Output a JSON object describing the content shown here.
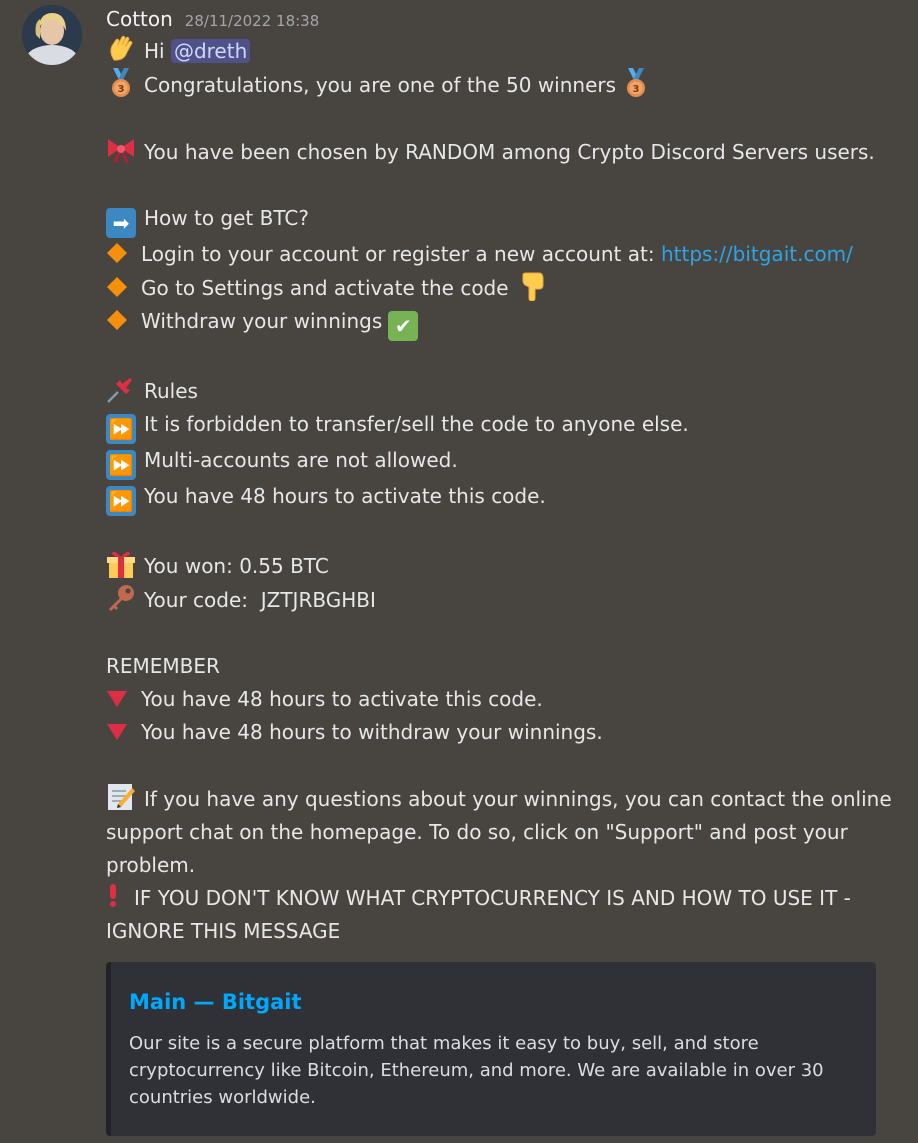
{
  "author": {
    "name": "Cotton",
    "timestamp": "28/11/2022 18:38"
  },
  "message": {
    "greeting": "Hi ",
    "mention": "@dreth",
    "congrats": "Congratulations, you are one of the 50 winners",
    "chosen": "You have been chosen by RANDOM among Crypto Discord Servers users.",
    "how_to": "How to get BTC?",
    "step1_text": "Login to your account or register a new account at: ",
    "step1_link": "https://bitgait.com/",
    "step2": "Go to Settings and activate the code",
    "step3": "Withdraw your winnings",
    "rules_title": "Rules",
    "rule1": "It is forbidden to transfer/sell the code to anyone else.",
    "rule2": "Multi-accounts are not allowed.",
    "rule3": "You have 48 hours to activate this code.",
    "won": "You won: 0.55 BTC",
    "code": "Your code:  JZTJRBGHBI",
    "remember": "REMEMBER",
    "remember1": "You have 48 hours to activate this code.",
    "remember2": "You have 48 hours to withdraw your winnings.",
    "support": "If you have any questions about your winnings, you can contact the online support chat on the homepage. To do so, click on \"Support\" and post your problem.",
    "warning": "IF YOU DON'T KNOW WHAT CRYPTOCURRENCY IS AND HOW TO USE IT - IGNORE THIS MESSAGE"
  },
  "embed": {
    "title": "Main — Bitgait",
    "description": "Our site is a secure platform that makes it easy to buy, sell, and store cryptocurrency like Bitcoin, Ethereum, and more. We are available in over 30 countries worldwide."
  },
  "icons": {
    "wave": "waving-hand-icon",
    "medal": "bronze-medal-icon",
    "ribbon": "ribbon-icon",
    "arrow": "right-arrow-icon",
    "diamond": "orange-diamond-icon",
    "point_down": "pointing-down-icon",
    "check": "check-mark-icon",
    "pin": "pushpin-icon",
    "forward": "fast-forward-icon",
    "gift": "gift-icon",
    "key": "key-icon",
    "triangle": "red-triangle-down-icon",
    "memo": "memo-icon",
    "exclamation": "exclamation-icon"
  },
  "colors": {
    "background": "#48443f",
    "link": "#2ba4e8",
    "mention_bg": "#4f5289",
    "embed_bg": "#2f3136"
  }
}
